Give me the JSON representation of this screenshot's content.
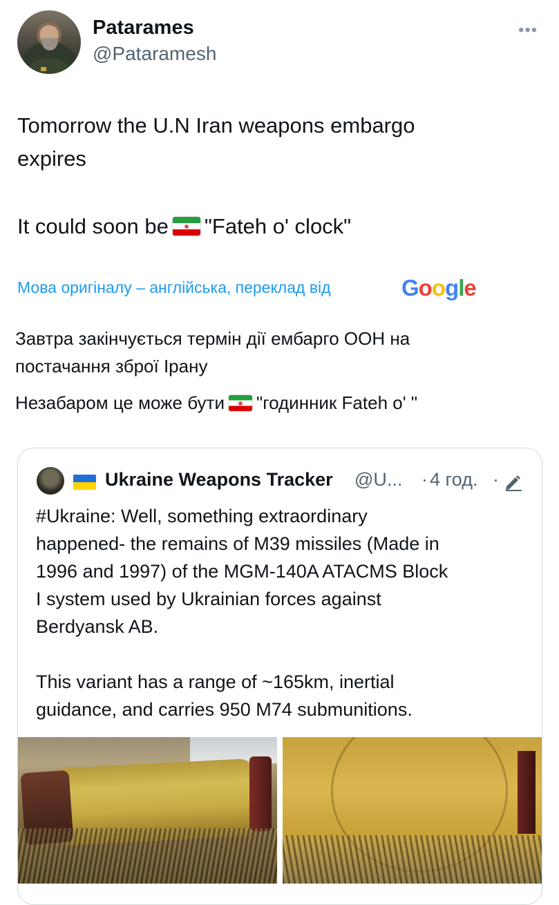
{
  "tweet": {
    "author": {
      "display_name": "Patarames",
      "handle": "@Pataramesh"
    },
    "more_icon": "more-horizontal-icon",
    "text_lines": [
      "Tomorrow the U.N Iran weapons embargo",
      "expires"
    ],
    "text_line3_before_flag": "It could soon be",
    "text_line3_after_flag": "\"Fateh o' clock\"",
    "flag_icon": "iran-flag-emoji"
  },
  "translation": {
    "note": "Мова оригіналу – англійська, переклад від",
    "provider": "Google",
    "lines": [
      "Завтра закінчується термін дії ембарго ООН на",
      "постачання зброї Ірану"
    ],
    "line3_before_flag": "Незабаром це може бути",
    "line3_after_flag": "\"годинник Fateh o' \""
  },
  "quoted_tweet": {
    "author_name": "Ukraine Weapons Tracker",
    "author_handle": "@U...",
    "separator": "·",
    "time": "4 год.",
    "flag_icon": "ukraine-flag-emoji",
    "edit_icon": "edited-pencil-icon",
    "text_lines": [
      "#Ukraine: Well, something extraordinary",
      "happened- the remains of M39 missiles (Made in",
      "1996 and 1997) of the MGM-140A ATACMS Block",
      "I system used by Ukrainian forces against",
      "Berdyansk AB.",
      "This variant has a range of ~165km, inertial",
      "guidance, and carries 950 M74 submunitions."
    ]
  },
  "colors": {
    "link_blue": "#1d9bf0",
    "secondary_text": "#536471",
    "border": "#cfd9de"
  }
}
